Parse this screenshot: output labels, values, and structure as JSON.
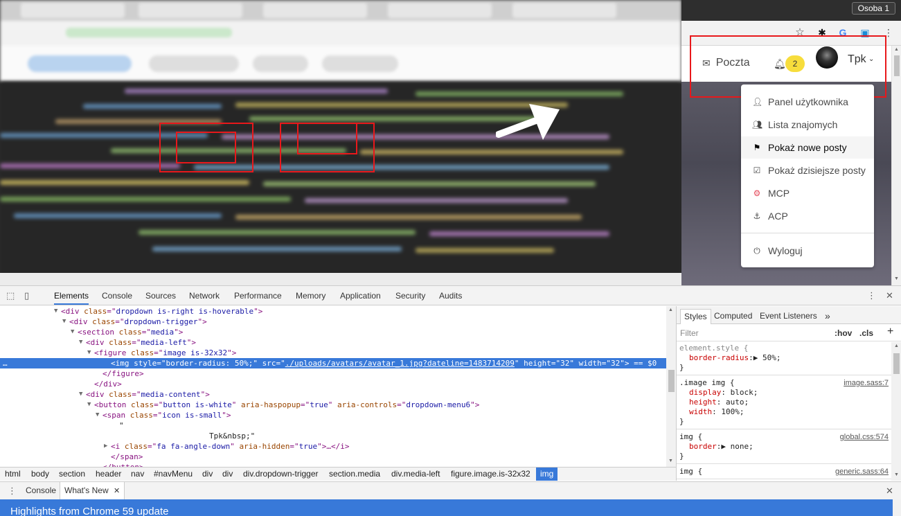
{
  "browser": {
    "profile_button": "Osoba 1"
  },
  "site_nav": {
    "mail_label": "Poczta",
    "notification_count": "2",
    "username": "Tpk"
  },
  "user_menu": {
    "items": [
      {
        "label": "Panel użytkownika",
        "icon": "user-icon"
      },
      {
        "label": "Lista znajomych",
        "icon": "users-icon"
      },
      {
        "label": "Pokaż nowe posty",
        "icon": "flag-icon"
      },
      {
        "label": "Pokaż dzisiejsze posty",
        "icon": "calendar-check-icon"
      },
      {
        "label": "MCP",
        "icon": "cog-icon"
      },
      {
        "label": "ACP",
        "icon": "anchor-icon"
      },
      {
        "label": "Wyloguj",
        "icon": "power-icon"
      }
    ],
    "active_index": 2
  },
  "devtools": {
    "tabs": [
      "Elements",
      "Console",
      "Sources",
      "Network",
      "Performance",
      "Memory",
      "Application",
      "Security",
      "Audits"
    ],
    "active_tab": "Elements",
    "dom_lines": [
      {
        "indent": 88,
        "tri": "▼",
        "parts": [
          [
            "tag",
            "<div "
          ],
          [
            "an",
            "class"
          ],
          [
            "tag",
            "=\""
          ],
          [
            "av",
            "dropdown is-right is-hoverable"
          ],
          [
            "tag",
            "\">"
          ]
        ]
      },
      {
        "indent": 100,
        "tri": "▼",
        "parts": [
          [
            "tag",
            "<div "
          ],
          [
            "an",
            "class"
          ],
          [
            "tag",
            "=\""
          ],
          [
            "av",
            "dropdown-trigger"
          ],
          [
            "tag",
            "\">"
          ]
        ]
      },
      {
        "indent": 112,
        "tri": "▼",
        "parts": [
          [
            "tag",
            "<section "
          ],
          [
            "an",
            "class"
          ],
          [
            "tag",
            "=\""
          ],
          [
            "av",
            "media"
          ],
          [
            "tag",
            "\">"
          ]
        ]
      },
      {
        "indent": 124,
        "tri": "▼",
        "parts": [
          [
            "tag",
            "<div "
          ],
          [
            "an",
            "class"
          ],
          [
            "tag",
            "=\""
          ],
          [
            "av",
            "media-left"
          ],
          [
            "tag",
            "\">"
          ]
        ]
      },
      {
        "indent": 136,
        "tri": "▼",
        "parts": [
          [
            "tag",
            "<figure "
          ],
          [
            "an",
            "class"
          ],
          [
            "tag",
            "=\""
          ],
          [
            "av",
            "image is-32x32"
          ],
          [
            "tag",
            "\">"
          ]
        ]
      },
      {
        "indent": 160,
        "tri": "",
        "sel": true,
        "parts": [
          [
            "tag",
            "<img "
          ],
          [
            "an",
            "style"
          ],
          [
            "tag",
            "=\""
          ],
          [
            "av",
            "border-radius: 50%;"
          ],
          [
            "tag",
            "\" "
          ],
          [
            "an",
            "src"
          ],
          [
            "tag",
            "=\""
          ],
          [
            "av",
            "./uploads/avatars/avatar_1.jpg?dateline=1483714209"
          ],
          [
            "tag",
            "\" "
          ],
          [
            "an",
            "height"
          ],
          [
            "tag",
            "=\""
          ],
          [
            "av",
            "32"
          ],
          [
            "tag",
            "\" "
          ],
          [
            "an",
            "width"
          ],
          [
            "tag",
            "=\""
          ],
          [
            "av",
            "32"
          ],
          [
            "tag",
            "\">"
          ],
          [
            "tx",
            " == $0"
          ]
        ]
      },
      {
        "indent": 148,
        "tri": "",
        "parts": [
          [
            "tag",
            "</figure>"
          ]
        ]
      },
      {
        "indent": 136,
        "tri": "",
        "parts": [
          [
            "tag",
            "</div>"
          ]
        ]
      },
      {
        "indent": 124,
        "tri": "▼",
        "parts": [
          [
            "tag",
            "<div "
          ],
          [
            "an",
            "class"
          ],
          [
            "tag",
            "=\""
          ],
          [
            "av",
            "media-content"
          ],
          [
            "tag",
            "\">"
          ]
        ]
      },
      {
        "indent": 136,
        "tri": "▼",
        "parts": [
          [
            "tag",
            "<button "
          ],
          [
            "an",
            "class"
          ],
          [
            "tag",
            "=\""
          ],
          [
            "av",
            "button is-white"
          ],
          [
            "tag",
            "\" "
          ],
          [
            "an",
            "aria-haspopup"
          ],
          [
            "tag",
            "=\""
          ],
          [
            "av",
            "true"
          ],
          [
            "tag",
            "\" "
          ],
          [
            "an",
            "aria-controls"
          ],
          [
            "tag",
            "=\""
          ],
          [
            "av",
            "dropdown-menu6"
          ],
          [
            "tag",
            "\">"
          ]
        ]
      },
      {
        "indent": 148,
        "tri": "▼",
        "parts": [
          [
            "tag",
            "<span "
          ],
          [
            "an",
            "class"
          ],
          [
            "tag",
            "=\""
          ],
          [
            "av",
            "icon is-small"
          ],
          [
            "tag",
            "\">"
          ]
        ]
      },
      {
        "indent": 172,
        "tri": "",
        "parts": [
          [
            "tx",
            "\""
          ]
        ]
      },
      {
        "indent": 302,
        "tri": "",
        "parts": [
          [
            "tx",
            "Tpk&nbsp;\""
          ]
        ]
      },
      {
        "indent": 160,
        "tri": "▶",
        "parts": [
          [
            "tag",
            "<i "
          ],
          [
            "an",
            "class"
          ],
          [
            "tag",
            "=\""
          ],
          [
            "av",
            "fa fa-angle-down"
          ],
          [
            "tag",
            "\" "
          ],
          [
            "an",
            "aria-hidden"
          ],
          [
            "tag",
            "=\""
          ],
          [
            "av",
            "true"
          ],
          [
            "tag",
            "\">…</i>"
          ]
        ]
      },
      {
        "indent": 160,
        "tri": "",
        "parts": [
          [
            "tag",
            "</span>"
          ]
        ]
      },
      {
        "indent": 148,
        "tri": "",
        "parts": [
          [
            "tag",
            "</button>"
          ]
        ]
      }
    ],
    "breadcrumbs": [
      "html",
      "body",
      "section",
      "header",
      "nav",
      "#navMenu",
      "div",
      "div",
      "div.dropdown-trigger",
      "section.media",
      "div.media-left",
      "figure.image.is-32x32",
      "img"
    ],
    "styles_tabs": [
      "Styles",
      "Computed",
      "Event Listeners"
    ],
    "filter_placeholder": "Filter",
    "hov": ":hov",
    "cls": ".cls",
    "rules": [
      {
        "selector": "element.style {",
        "source": "",
        "props": [
          [
            "border-radius",
            "▶ 50%;"
          ]
        ]
      },
      {
        "selector": ".image img {",
        "source": "image.sass:7",
        "props": [
          [
            "display",
            " block;"
          ],
          [
            "height",
            " auto;"
          ],
          [
            "width",
            " 100%;"
          ]
        ]
      },
      {
        "selector": "img {",
        "source": "global.css:574",
        "props": [
          [
            "border",
            "▶ none;"
          ]
        ]
      },
      {
        "selector": "img {",
        "source": "generic.sass:64",
        "props": []
      }
    ],
    "drawer_tabs": [
      "Console",
      "What's New"
    ],
    "whats_new_title": "Highlights from Chrome 59 update"
  }
}
